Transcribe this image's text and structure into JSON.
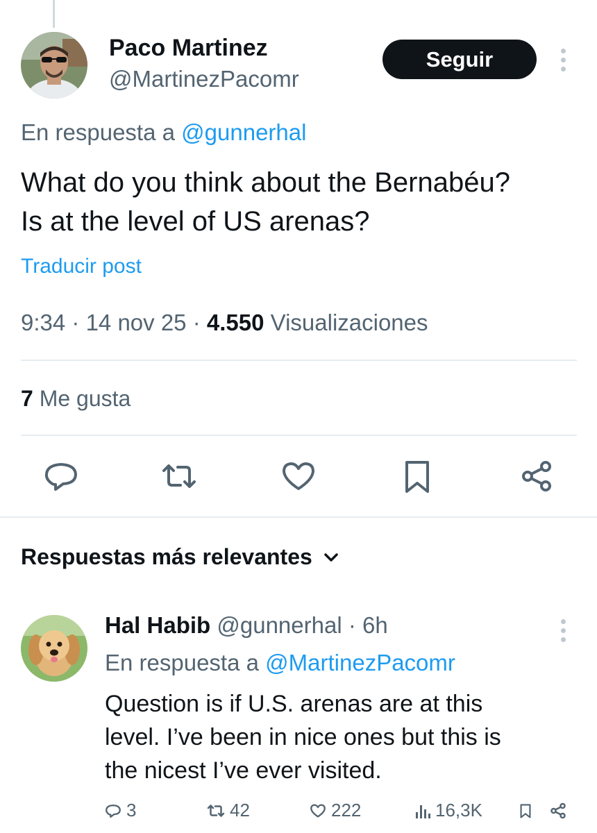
{
  "tweet": {
    "author_name": "Paco Martinez",
    "author_handle": "@MartinezPacomr",
    "follow_label": "Seguir",
    "reply_prefix": "En respuesta a",
    "reply_to_handle": "@gunnerhal",
    "text_lines": [
      "What do you think about the Bernabéu?",
      "Is at the level of US arenas?"
    ],
    "translate_label": "Traducir post",
    "time": "9:34",
    "date": "14 nov 25",
    "separator": "·",
    "views_count": "4.550",
    "views_label": "Visualizaciones",
    "likes_count": "7",
    "likes_label": "Me gusta",
    "actions": [
      "reply-icon",
      "retweet-icon",
      "heart-icon",
      "bookmark-icon",
      "share-icon"
    ]
  },
  "replies_section": {
    "title": "Respuestas más relevantes"
  },
  "reply": {
    "author_name": "Hal Habib",
    "author_handle": "@gunnerhal",
    "age": "6h",
    "reply_prefix": "En respuesta a",
    "reply_to_handle": "@MartinezPacomr",
    "text_lines": [
      "Question is if U.S. arenas are at this",
      "level. I’ve been in nice ones but this is",
      "the nicest I’ve ever visited."
    ],
    "stats": {
      "replies": "3",
      "retweets": "42",
      "likes": "222",
      "views": "16,3K"
    }
  },
  "colors": {
    "text": "#0f1419",
    "secondary": "#536471",
    "link": "#1d9bf0",
    "button": "#0f1419",
    "divider": "#e6ecf0"
  }
}
